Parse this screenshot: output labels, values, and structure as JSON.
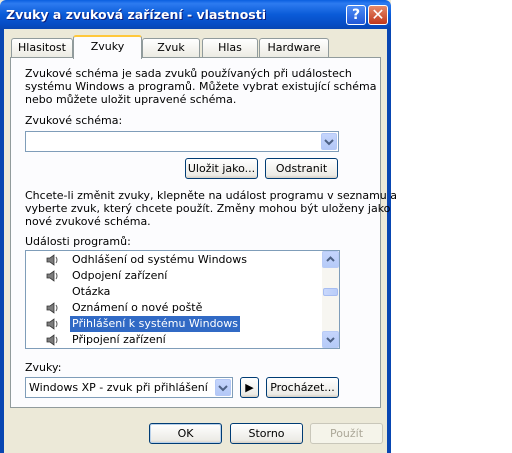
{
  "window": {
    "title": "Zvuky a zvuková zařízení - vlastnosti",
    "help_label": "?",
    "close_label": "✕"
  },
  "tabs": [
    {
      "label": "Hlasitost"
    },
    {
      "label": "Zvuky",
      "active": true
    },
    {
      "label": "Zvuk"
    },
    {
      "label": "Hlas"
    },
    {
      "label": "Hardware"
    }
  ],
  "sounds_tab": {
    "intro_lines": [
      "Zvukové schéma je sada zvuků používaných při událostech",
      "systému Windows a programů. Můžete vybrat existující schéma",
      "nebo můžete uložit upravené schéma."
    ],
    "scheme_label": "Zvukové schéma:",
    "scheme_value": "",
    "save_as_button": "Uložit jako...",
    "delete_button": "Odstranit",
    "change_lines": [
      "Chcete-li změnit zvuky, klepněte na událost programu v seznamu a",
      "vyberte zvuk, který chcete použít. Změny mohou být uloženy jako",
      "nové zvukové schéma."
    ],
    "events_label": "Události programů:",
    "events": [
      {
        "label": "Odhlášení od systému Windows",
        "icon": "speaker-icon"
      },
      {
        "label": "Odpojení zařízení",
        "icon": "speaker-icon"
      },
      {
        "label": "Otázka",
        "icon": ""
      },
      {
        "label": "Oznámení o nové poště",
        "icon": "speaker-icon"
      },
      {
        "label": "Přihlášení k systému Windows",
        "icon": "speaker-icon",
        "selected": true
      },
      {
        "label": "Připojení zařízení",
        "icon": "speaker-icon"
      }
    ],
    "sounds_label": "Zvuky:",
    "sound_value": "Windows XP - zvuk při přihlášení",
    "play_label": "▶",
    "browse_button": "Procházet..."
  },
  "footer": {
    "ok": "OK",
    "cancel": "Storno",
    "apply": "Použít"
  },
  "colors": {
    "accent": "#316AC5",
    "titlebar": "#0A5BD8",
    "face": "#ECE9D8"
  }
}
